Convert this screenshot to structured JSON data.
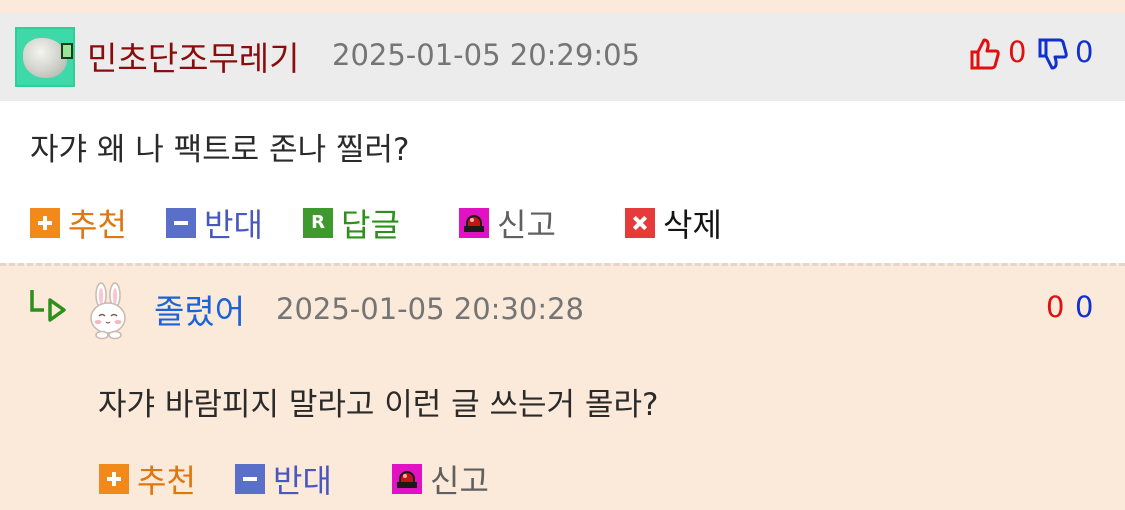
{
  "comments": [
    {
      "nickname": "민초단조무레기",
      "timestamp": "2025-01-05 20:29:05",
      "upvotes": "0",
      "downvotes": "0",
      "text": "자갸 왜 나 팩트로 존나 찔러?",
      "actions": {
        "recommend": "추천",
        "oppose": "반대",
        "reply": "답글",
        "report": "신고",
        "delete": "삭제"
      }
    },
    {
      "nickname": "졸렸어",
      "timestamp": "2025-01-05 20:30:28",
      "upvotes": "0",
      "downvotes": "0",
      "text": "자갸 바람피지 말라고 이런 글 쓰는거 몰라?",
      "actions": {
        "recommend": "추천",
        "oppose": "반대",
        "report": "신고"
      }
    }
  ],
  "icons": {
    "thumbs_up": "thumbs-up-icon",
    "thumbs_down": "thumbs-down-icon",
    "reply_arrow": "reply-arrow-icon",
    "avatar_rock": "rock-avatar",
    "avatar_bunny": "bunny-avatar"
  },
  "colors": {
    "nickname_1": "#8a0d0d",
    "nickname_2": "#1a64d8",
    "upvote": "#e01010",
    "downvote": "#1030d0",
    "recommend": "#e0760f",
    "oppose": "#4858c0",
    "reply": "#2d8f1c",
    "reply_bg": "#fbe9d9",
    "header_bg": "#ececec"
  }
}
